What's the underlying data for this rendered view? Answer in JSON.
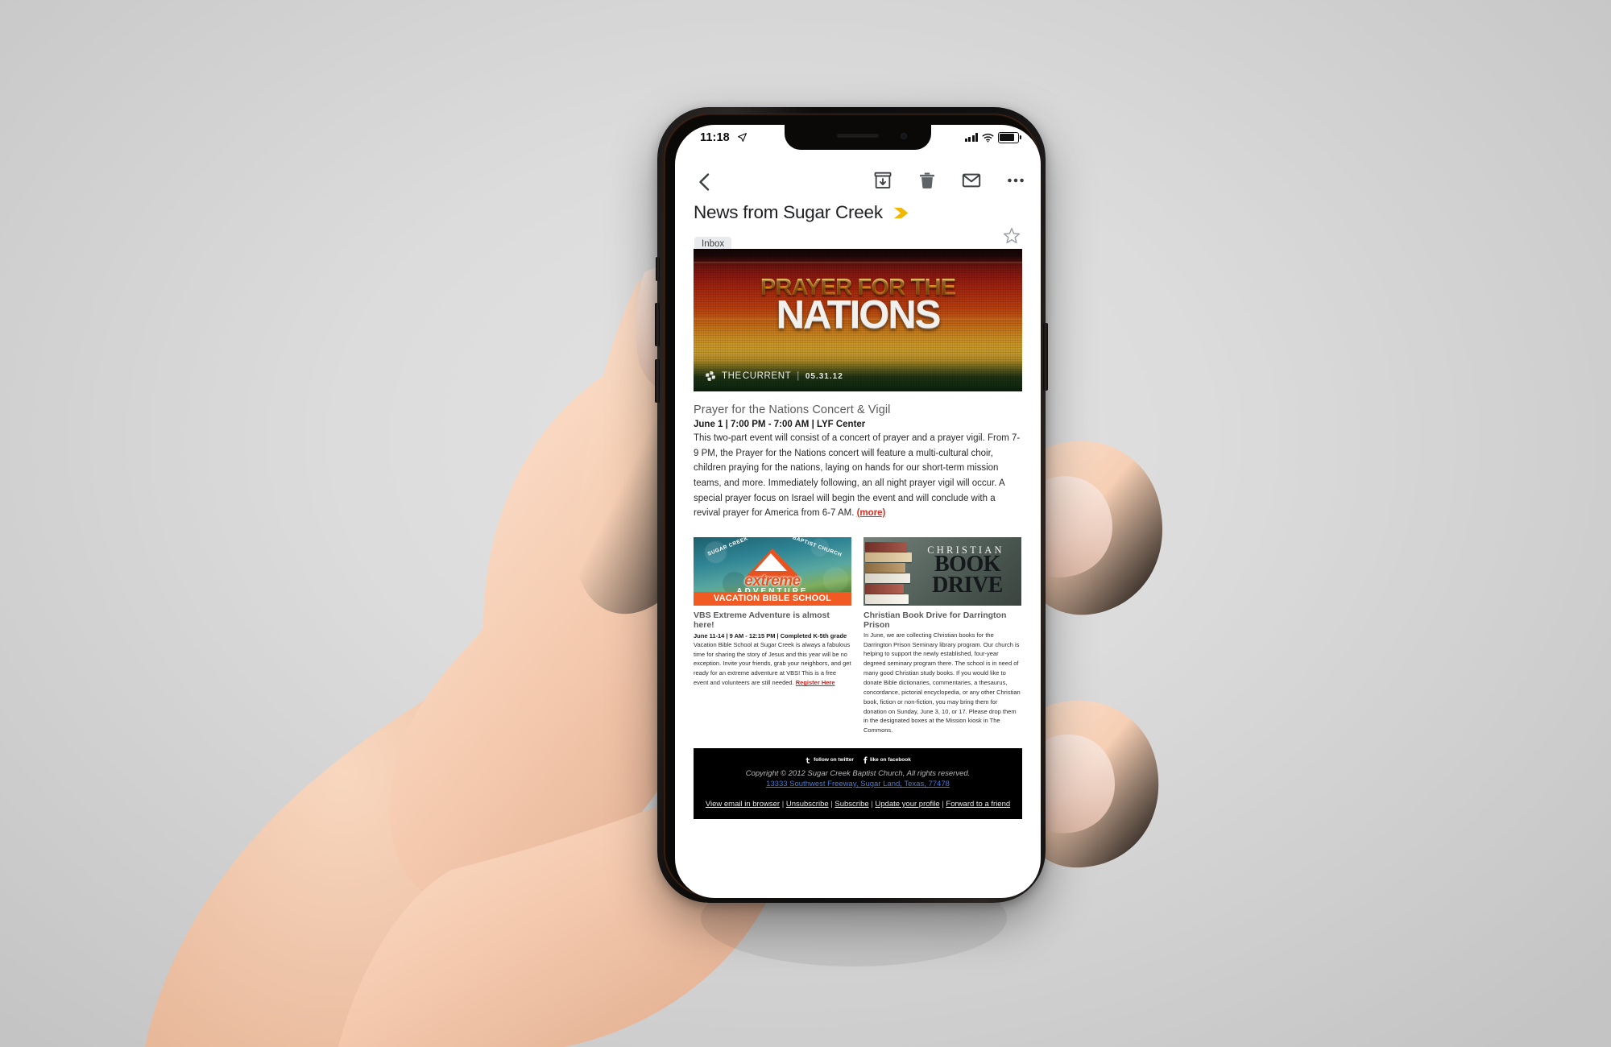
{
  "status_bar": {
    "time": "11:18",
    "location_icon": "location-arrow-icon",
    "signal_icon": "cellular-signal-icon",
    "wifi_icon": "wifi-icon",
    "battery_icon": "battery-icon"
  },
  "toolbar": {
    "back_icon": "back-chevron-icon",
    "archive_icon": "archive-icon",
    "delete_icon": "trash-icon",
    "mark_unread_icon": "envelope-icon",
    "more_icon": "more-options-icon"
  },
  "email_header": {
    "subject": "News from Sugar Creek",
    "importance_marker": "important-chevron-icon",
    "star_icon": "star-outline-icon",
    "label": "Inbox"
  },
  "banner": {
    "title_top": "PRAYER FOR THE",
    "title_bottom": "NATIONS",
    "brand_the": "THE",
    "brand_current": "CURRENT",
    "divider": "|",
    "date": "05.31.12",
    "logo_icon": "pinwheel-cross-icon"
  },
  "article": {
    "heading": "Prayer for the Nations Concert & Vigil",
    "meta": "June 1 | 7:00 PM - 7:00 AM | LYF Center",
    "body": "This two-part event will consist of a concert of prayer and a prayer vigil. From 7-9 PM, the Prayer for the Nations concert will feature a multi-cultural choir, children praying for the nations, laying on hands for our short-term mission teams, and more. Immediately following, an all night prayer vigil will occur. A special prayer focus on Israel will begin the event and will conclude with a revival prayer for America from 6-7 AM. ",
    "more_link": "(more)"
  },
  "columns": [
    {
      "image_alt": "vbs-extreme-adventure-banner",
      "image_text": {
        "arc_left": "SUGAR CREEK",
        "arc_right": "BAPTIST CHURCH",
        "word": "extreme",
        "adventure": "ADVENTURE",
        "bar": "VACATION BIBLE SCHOOL"
      },
      "heading": "VBS Extreme Adventure is almost here!",
      "meta": "June 11-14 | 9 AM - 12:15 PM | Completed K-5th grade",
      "body": "Vacation Bible School at Sugar Creek is always a fabulous time for sharing the story of Jesus and this year will be no exception. Invite your friends, grab your neighbors, and get ready for an extreme adventure at VBS! This is a free event and volunteers are still needed. ",
      "link": "Register Here"
    },
    {
      "image_alt": "christian-book-drive-banner",
      "image_text": {
        "line1": "CHRISTIAN",
        "line2": "BOOK",
        "line3": "DRIVE"
      },
      "heading": "Christian Book Drive for Darrington Prison",
      "meta": "",
      "body": "In June, we are collecting Christian books for the Darrington Prison Seminary library program. Our church is helping to support the newly established, four-year degreed seminary program there. The school is in need of many good Christian study books. If you would like to donate Bible dictionaries, commentaries, a thesaurus, concordance, pictorial encyclopedia, or any other Christian book, fiction or non-fiction, you may bring them for donation on Sunday, June 3, 10, or 17. Please drop them in the designated boxes at the Mission kiosk in The Commons.",
      "link": ""
    }
  ],
  "footer": {
    "twitter_label": "follow on twitter",
    "facebook_label": "like on facebook",
    "twitter_icon": "twitter-icon",
    "facebook_icon": "facebook-icon",
    "copyright": "Copyright © 2012 Sugar Creek Baptist Church, All rights reserved.",
    "address": "13333 Southwest Freeway, Sugar Land, Texas, 77478",
    "links": [
      "View email in browser",
      "Unsubscribe",
      "Subscribe",
      "Update your profile",
      "Forward to a friend"
    ],
    "separator": "|"
  },
  "colors": {
    "important_chevron": "#f2b705",
    "more_link": "#d93025",
    "register_link": "#c5221f",
    "address_link": "#4a79d4",
    "label_chip_bg": "#e8eaed",
    "footer_bg": "#000000"
  }
}
